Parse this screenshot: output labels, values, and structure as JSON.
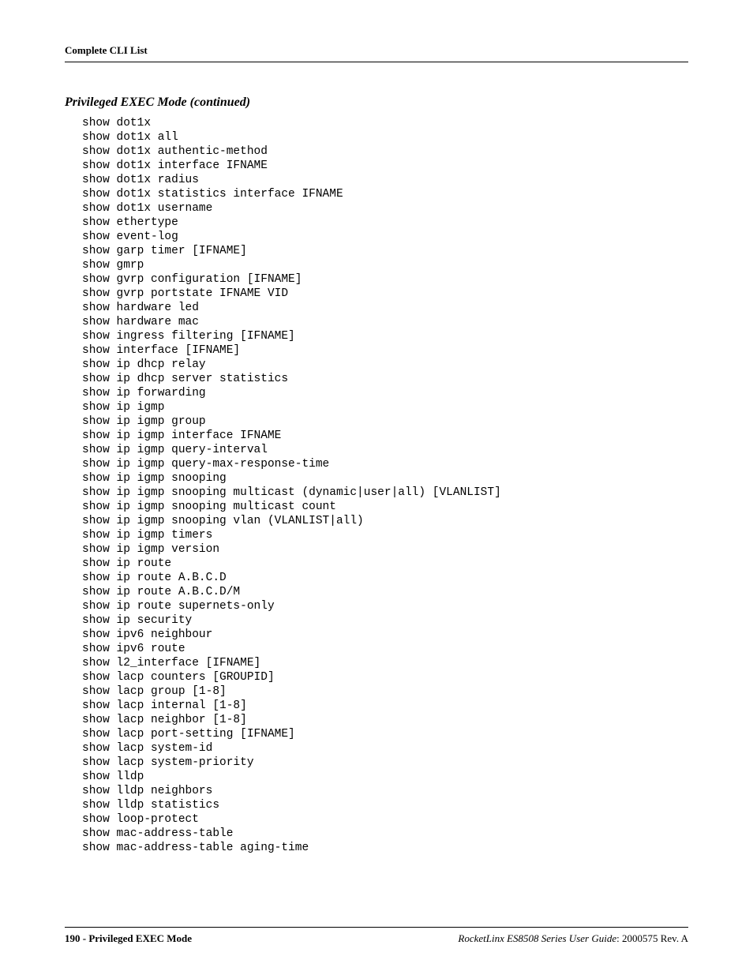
{
  "header": {
    "title": "Complete CLI List"
  },
  "section": {
    "heading": "Privileged EXEC Mode (continued)"
  },
  "cli_lines": [
    "show dot1x",
    "show dot1x all",
    "show dot1x authentic-method",
    "show dot1x interface IFNAME",
    "show dot1x radius",
    "show dot1x statistics interface IFNAME",
    "show dot1x username",
    "show ethertype",
    "show event-log",
    "show garp timer [IFNAME]",
    "show gmrp",
    "show gvrp configuration [IFNAME]",
    "show gvrp portstate IFNAME VID",
    "show hardware led",
    "show hardware mac",
    "show ingress filtering [IFNAME]",
    "show interface [IFNAME]",
    "show ip dhcp relay",
    "show ip dhcp server statistics",
    "show ip forwarding",
    "show ip igmp",
    "show ip igmp group",
    "show ip igmp interface IFNAME",
    "show ip igmp query-interval",
    "show ip igmp query-max-response-time",
    "show ip igmp snooping",
    "show ip igmp snooping multicast (dynamic|user|all) [VLANLIST]",
    "show ip igmp snooping multicast count",
    "show ip igmp snooping vlan (VLANLIST|all)",
    "show ip igmp timers",
    "show ip igmp version",
    "show ip route",
    "show ip route A.B.C.D",
    "show ip route A.B.C.D/M",
    "show ip route supernets-only",
    "show ip security",
    "show ipv6 neighbour",
    "show ipv6 route",
    "show l2_interface [IFNAME]",
    "show lacp counters [GROUPID]",
    "show lacp group [1-8]",
    "show lacp internal [1-8]",
    "show lacp neighbor [1-8]",
    "show lacp port-setting [IFNAME]",
    "show lacp system-id",
    "show lacp system-priority",
    "show lldp",
    "show lldp neighbors",
    "show lldp statistics",
    "show loop-protect",
    "show mac-address-table",
    "show mac-address-table aging-time"
  ],
  "footer": {
    "left": "190 - Privileged EXEC Mode",
    "right_italic": "RocketLinx ES8508 Series  User Guide",
    "right_rest": ": 2000575 Rev. A"
  }
}
